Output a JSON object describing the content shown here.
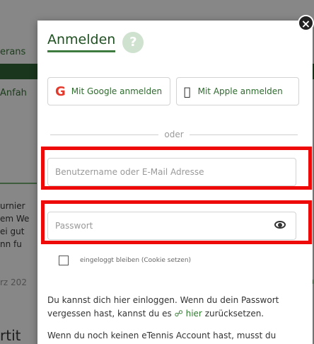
{
  "background": {
    "fragments": [
      "erans",
      "Anfah",
      "urnier",
      "em We",
      "ei gut",
      "nn  fu",
      "rz 202",
      "la",
      "rtit"
    ]
  },
  "dialog": {
    "title": "Anmelden",
    "help_icon": "?",
    "close_icon": "×",
    "google_button": "Mit Google anmelden",
    "apple_button": "Mit Apple anmelden",
    "divider_text": "oder",
    "username_placeholder": "Benutzername oder E-Mail Adresse",
    "password_placeholder": "Passwort",
    "remember_label": "eingeloggt bleiben (Cookie setzen)",
    "info_text_1a": "Du kannst dich hier einloggen. Wenn du dein Passwort vergessen hast, kannst du es ",
    "info_link": "hier",
    "info_text_1b": " zurücksetzen.",
    "info_text_2": "Wenn du noch keinen eTennis Account hast, musst du"
  },
  "colors": {
    "accent_green": "#2f6b2f",
    "highlight_red": "#ef0a0a"
  },
  "icons": {
    "google": "google-logo-icon",
    "apple": "apple-logo-icon",
    "eye": "eye-icon",
    "link": "link-icon",
    "help": "question-mark-icon",
    "close": "close-icon"
  }
}
